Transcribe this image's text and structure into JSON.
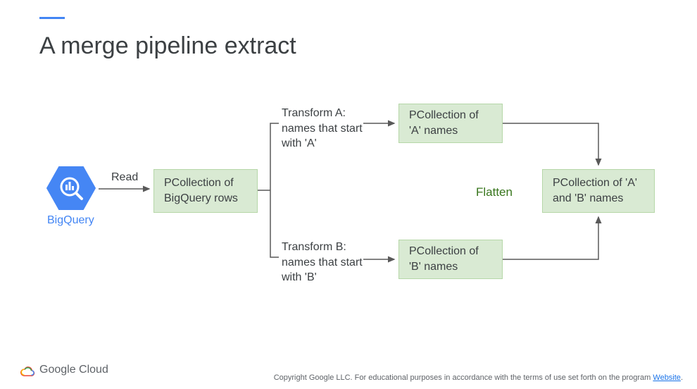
{
  "title": "A merge pipeline extract",
  "nodes": {
    "bigquery": "BigQuery",
    "read": "Read",
    "pcoll_rows": "PCollection of BigQuery rows",
    "transform_a": "Transform A: names that start with 'A'",
    "transform_b": "Transform B: names that start with 'B'",
    "pcoll_a": "PCollection of 'A' names",
    "pcoll_b": "PCollection of 'B' names",
    "flatten": "Flatten",
    "pcoll_ab": "PCollection of 'A' and 'B' names"
  },
  "footer": {
    "brand": "Google Cloud",
    "copyright": "Copyright Google LLC. For educational purposes in accordance with the terms of use set forth on the program ",
    "link_text": "Website"
  }
}
